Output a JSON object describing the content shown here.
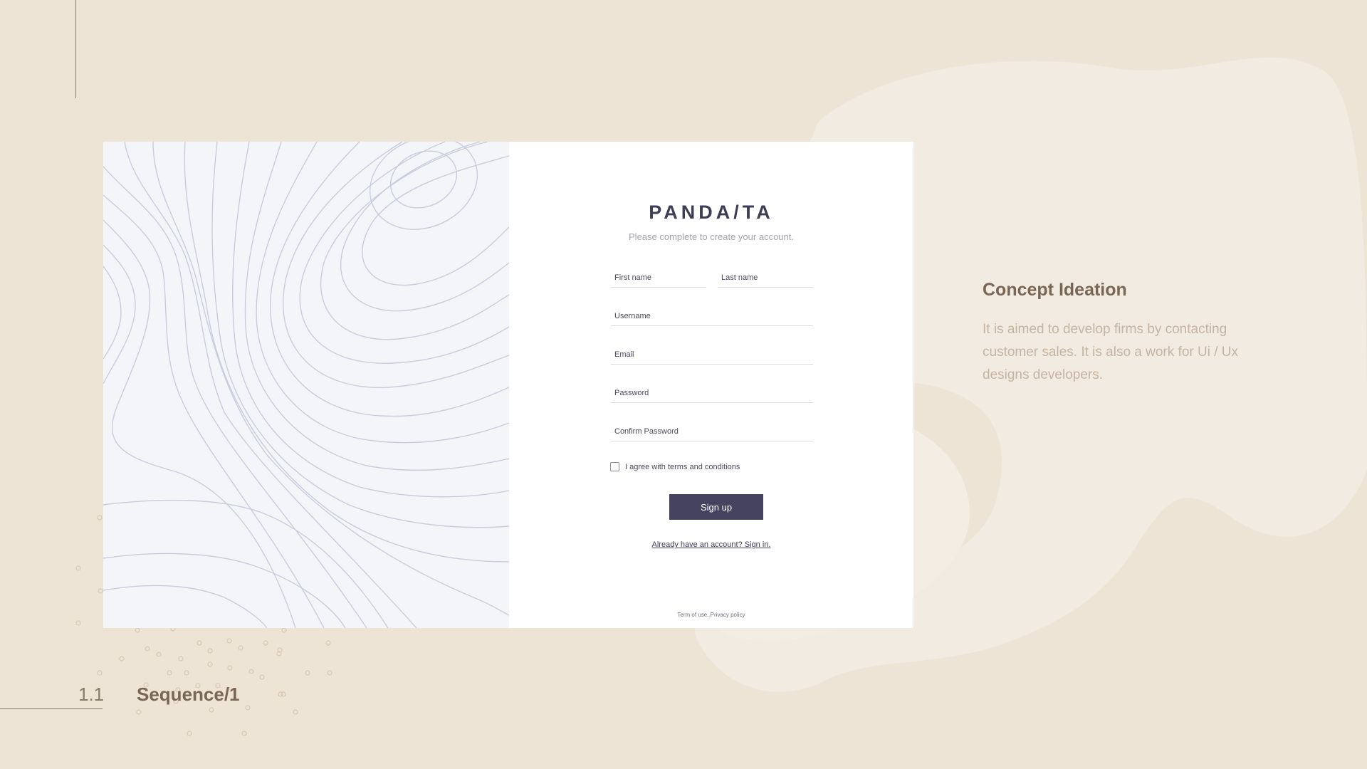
{
  "colors": {
    "background": "#EEE4D6",
    "blob_light": "#F2ECE3",
    "card": "#FFFFFF",
    "art_panel": "#F4F5F9",
    "contour_line": "#C9CCDD",
    "brand_text": "#3E3D58",
    "button": "#45435F",
    "heading": "#7A6655",
    "body_text": "#C6B3A0",
    "dot": "#D9C6B4"
  },
  "slide": {
    "number": "1.1",
    "title": "Sequence/1"
  },
  "form": {
    "brand": "PANDA/TA",
    "subtitle": "Please complete to create your account.",
    "first_name_placeholder": "First name",
    "last_name_placeholder": "Last name",
    "username_placeholder": "Username",
    "email_placeholder": "Email",
    "password_placeholder": "Password",
    "confirm_password_placeholder": "Confirm Password",
    "agree_label": "I agree with terms and conditions",
    "agree_checked": false,
    "signup_label": "Sign up",
    "signin_link": "Already have an account? Sign in.",
    "footer": "Term of use. Privacy policy"
  },
  "concept": {
    "title": "Concept Ideation",
    "text": "It is aimed to develop firms by contacting customer sales. It is also a work for Ui / Ux designs developers."
  },
  "icons": {
    "checkbox": "checkbox-empty-icon",
    "art": "topographic-contour-pattern"
  }
}
